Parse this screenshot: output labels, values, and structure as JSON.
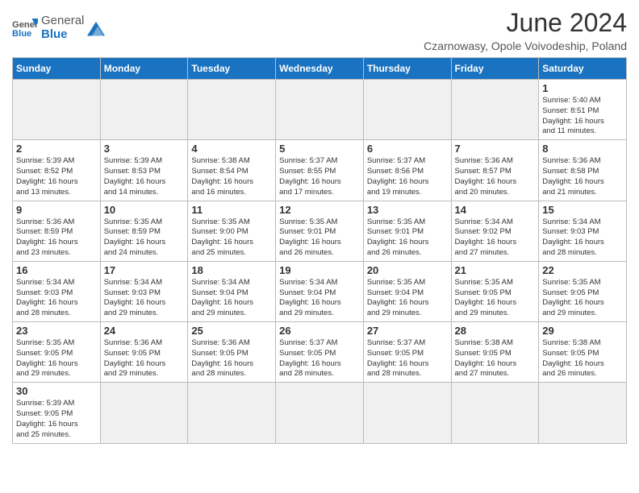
{
  "header": {
    "logo_general": "General",
    "logo_blue": "Blue",
    "month_title": "June 2024",
    "subtitle": "Czarnowasy, Opole Voivodeship, Poland"
  },
  "weekdays": [
    "Sunday",
    "Monday",
    "Tuesday",
    "Wednesday",
    "Thursday",
    "Friday",
    "Saturday"
  ],
  "days": [
    {
      "num": "",
      "empty": true
    },
    {
      "num": "",
      "empty": true
    },
    {
      "num": "",
      "empty": true
    },
    {
      "num": "",
      "empty": true
    },
    {
      "num": "",
      "empty": true
    },
    {
      "num": "",
      "empty": true
    },
    {
      "num": "1",
      "sunrise": "5:40 AM",
      "sunset": "8:51 PM",
      "daylight": "16 hours and 11 minutes."
    },
    {
      "num": "2",
      "sunrise": "5:39 AM",
      "sunset": "8:52 PM",
      "daylight": "16 hours and 13 minutes."
    },
    {
      "num": "3",
      "sunrise": "5:39 AM",
      "sunset": "8:53 PM",
      "daylight": "16 hours and 14 minutes."
    },
    {
      "num": "4",
      "sunrise": "5:38 AM",
      "sunset": "8:54 PM",
      "daylight": "16 hours and 16 minutes."
    },
    {
      "num": "5",
      "sunrise": "5:37 AM",
      "sunset": "8:55 PM",
      "daylight": "16 hours and 17 minutes."
    },
    {
      "num": "6",
      "sunrise": "5:37 AM",
      "sunset": "8:56 PM",
      "daylight": "16 hours and 19 minutes."
    },
    {
      "num": "7",
      "sunrise": "5:36 AM",
      "sunset": "8:57 PM",
      "daylight": "16 hours and 20 minutes."
    },
    {
      "num": "8",
      "sunrise": "5:36 AM",
      "sunset": "8:58 PM",
      "daylight": "16 hours and 21 minutes."
    },
    {
      "num": "9",
      "sunrise": "5:36 AM",
      "sunset": "8:59 PM",
      "daylight": "16 hours and 23 minutes."
    },
    {
      "num": "10",
      "sunrise": "5:35 AM",
      "sunset": "8:59 PM",
      "daylight": "16 hours and 24 minutes."
    },
    {
      "num": "11",
      "sunrise": "5:35 AM",
      "sunset": "9:00 PM",
      "daylight": "16 hours and 25 minutes."
    },
    {
      "num": "12",
      "sunrise": "5:35 AM",
      "sunset": "9:01 PM",
      "daylight": "16 hours and 26 minutes."
    },
    {
      "num": "13",
      "sunrise": "5:35 AM",
      "sunset": "9:01 PM",
      "daylight": "16 hours and 26 minutes."
    },
    {
      "num": "14",
      "sunrise": "5:34 AM",
      "sunset": "9:02 PM",
      "daylight": "16 hours and 27 minutes."
    },
    {
      "num": "15",
      "sunrise": "5:34 AM",
      "sunset": "9:03 PM",
      "daylight": "16 hours and 28 minutes."
    },
    {
      "num": "16",
      "sunrise": "5:34 AM",
      "sunset": "9:03 PM",
      "daylight": "16 hours and 28 minutes."
    },
    {
      "num": "17",
      "sunrise": "5:34 AM",
      "sunset": "9:03 PM",
      "daylight": "16 hours and 29 minutes."
    },
    {
      "num": "18",
      "sunrise": "5:34 AM",
      "sunset": "9:04 PM",
      "daylight": "16 hours and 29 minutes."
    },
    {
      "num": "19",
      "sunrise": "5:34 AM",
      "sunset": "9:04 PM",
      "daylight": "16 hours and 29 minutes."
    },
    {
      "num": "20",
      "sunrise": "5:35 AM",
      "sunset": "9:04 PM",
      "daylight": "16 hours and 29 minutes."
    },
    {
      "num": "21",
      "sunrise": "5:35 AM",
      "sunset": "9:05 PM",
      "daylight": "16 hours and 29 minutes."
    },
    {
      "num": "22",
      "sunrise": "5:35 AM",
      "sunset": "9:05 PM",
      "daylight": "16 hours and 29 minutes."
    },
    {
      "num": "23",
      "sunrise": "5:35 AM",
      "sunset": "9:05 PM",
      "daylight": "16 hours and 29 minutes."
    },
    {
      "num": "24",
      "sunrise": "5:36 AM",
      "sunset": "9:05 PM",
      "daylight": "16 hours and 29 minutes."
    },
    {
      "num": "25",
      "sunrise": "5:36 AM",
      "sunset": "9:05 PM",
      "daylight": "16 hours and 28 minutes."
    },
    {
      "num": "26",
      "sunrise": "5:37 AM",
      "sunset": "9:05 PM",
      "daylight": "16 hours and 28 minutes."
    },
    {
      "num": "27",
      "sunrise": "5:37 AM",
      "sunset": "9:05 PM",
      "daylight": "16 hours and 28 minutes."
    },
    {
      "num": "28",
      "sunrise": "5:38 AM",
      "sunset": "9:05 PM",
      "daylight": "16 hours and 27 minutes."
    },
    {
      "num": "29",
      "sunrise": "5:38 AM",
      "sunset": "9:05 PM",
      "daylight": "16 hours and 26 minutes."
    },
    {
      "num": "30",
      "sunrise": "5:39 AM",
      "sunset": "9:05 PM",
      "daylight": "16 hours and 25 minutes."
    }
  ],
  "labels": {
    "sunrise_label": "Sunrise:",
    "sunset_label": "Sunset:",
    "daylight_label": "Daylight:"
  }
}
